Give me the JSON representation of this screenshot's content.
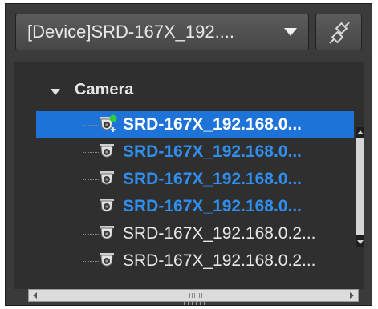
{
  "toolbar": {
    "device_select_value": "[Device]SRD-167X_192....",
    "link_button_icon": "link-plug-icon"
  },
  "tree": {
    "group_label": "Camera",
    "items": [
      {
        "label": "SRD-167X_192.168.0...",
        "style": "white-bold",
        "selected": true,
        "icon": "camera-add-icon"
      },
      {
        "label": "SRD-167X_192.168.0...",
        "style": "blue-bold",
        "selected": false,
        "icon": "camera-icon"
      },
      {
        "label": "SRD-167X_192.168.0...",
        "style": "blue-bold",
        "selected": false,
        "icon": "camera-icon"
      },
      {
        "label": "SRD-167X_192.168.0...",
        "style": "blue-bold",
        "selected": false,
        "icon": "camera-icon"
      },
      {
        "label": "SRD-167X_192.168.0.2...",
        "style": "normal",
        "selected": false,
        "icon": "camera-icon"
      },
      {
        "label": "SRD-167X_192.168.0.2...",
        "style": "normal",
        "selected": false,
        "icon": "camera-icon"
      }
    ]
  },
  "colors": {
    "selection": "#1d73d8",
    "highlight_text": "#2e8ff0"
  }
}
